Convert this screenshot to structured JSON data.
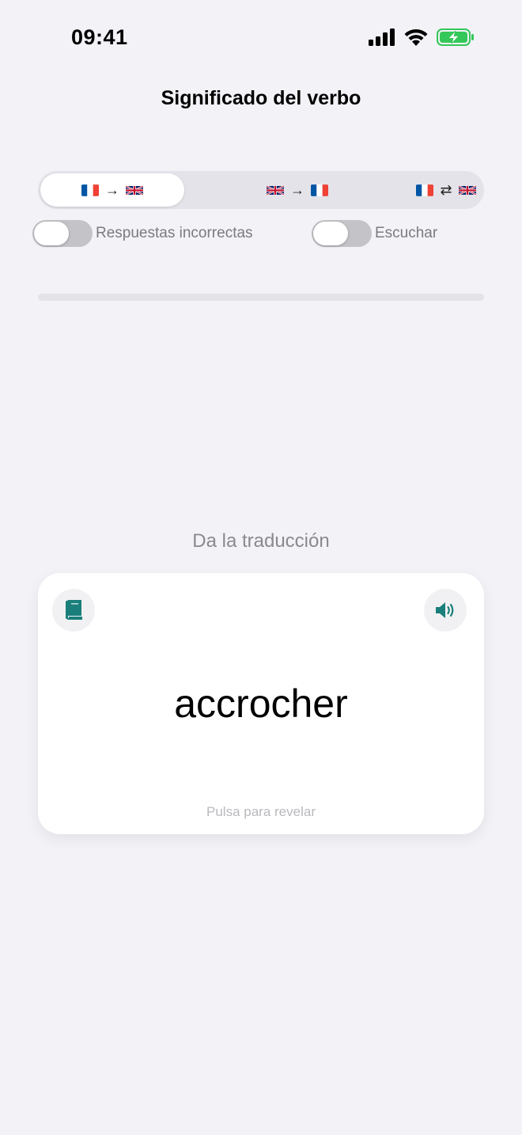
{
  "status_bar": {
    "time": "09:41"
  },
  "nav": {
    "title": "Significado del verbo"
  },
  "direction_segments": [
    {
      "from": "FR",
      "symbol": "→",
      "to": "GB",
      "selected": true
    },
    {
      "from": "GB",
      "symbol": "→",
      "to": "FR",
      "selected": false
    },
    {
      "from": "FR",
      "symbol": "⇄",
      "to": "GB",
      "selected": false
    }
  ],
  "toggles": [
    {
      "label": "Respuestas incorrectas",
      "on": false
    },
    {
      "label": "Escuchar",
      "on": false
    }
  ],
  "progress": {
    "fraction": 0
  },
  "prompt": "Da la traducción",
  "card": {
    "word": "accrocher",
    "hint": "Pulsa para revelar",
    "left_icon": "book-icon",
    "right_icon": "speaker-icon"
  },
  "colors": {
    "accent": "#1a7f7a",
    "background": "#f2f2f7",
    "battery": "#34c759"
  }
}
